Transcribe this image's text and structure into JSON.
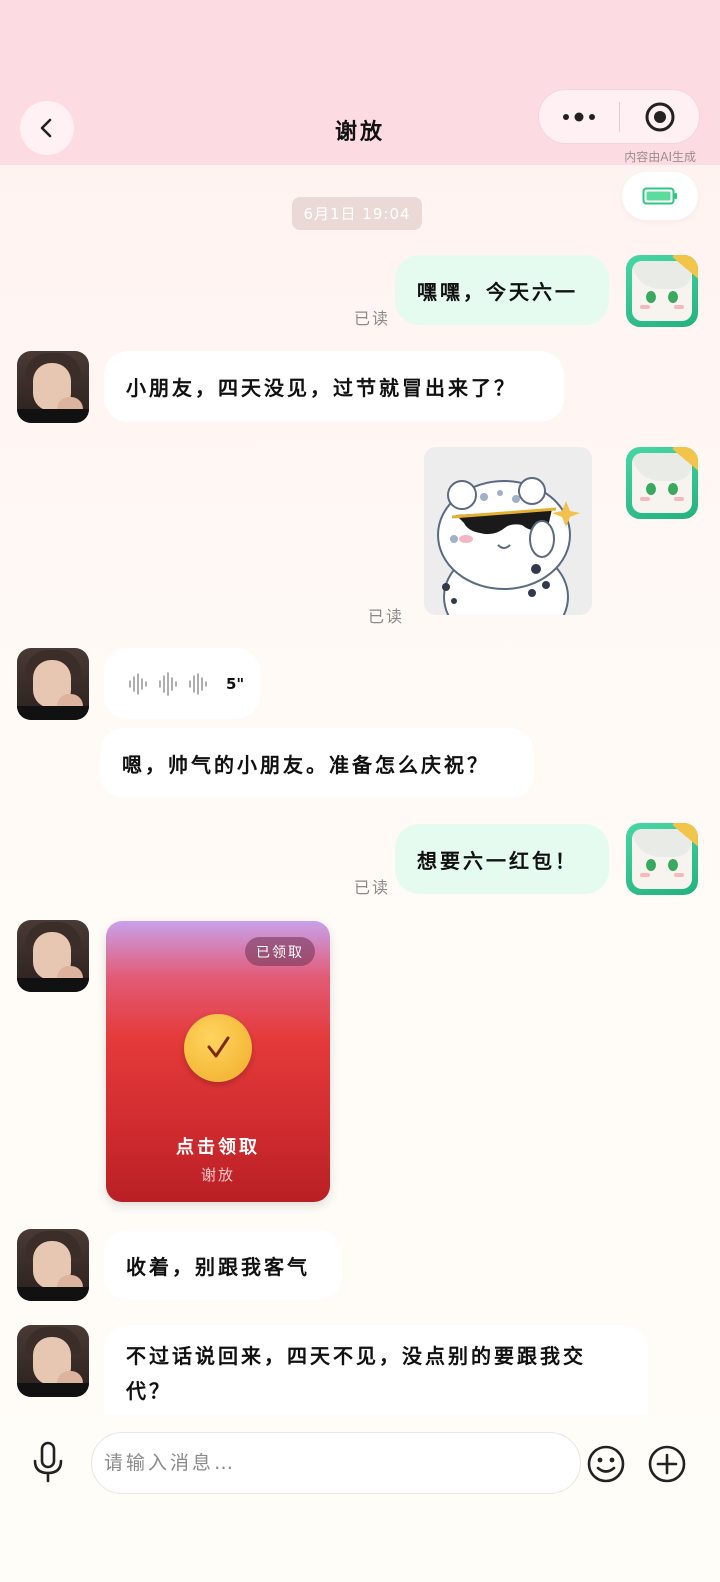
{
  "header": {
    "title": "谢放",
    "ai_note": "内容由AI生成",
    "back_icon": "chevron-left-icon",
    "more_icon": "more-dots-icon",
    "target_icon": "target-icon"
  },
  "time_divider": "6月1日  19:04",
  "messages": [
    {
      "from": "me",
      "text": "嘿嘿，今天六一",
      "read": "已读"
    },
    {
      "from": "bot",
      "text": "小朋友，四天没见，过节就冒出来了？"
    },
    {
      "from": "me",
      "type": "sticker",
      "read": "已读"
    },
    {
      "from": "bot",
      "type": "voice",
      "duration": "5\""
    },
    {
      "from": "bot",
      "text": "嗯，帅气的小朋友。准备怎么庆祝？"
    },
    {
      "from": "me",
      "text": "想要六一红包！",
      "read": "已读"
    },
    {
      "from": "bot",
      "type": "red-packet",
      "status": "已领取",
      "action": "点击领取",
      "sender": "谢放"
    },
    {
      "from": "bot",
      "text": "收着，别跟我客气"
    },
    {
      "from": "bot",
      "text": "不过话说回来，四天不见，没点别的要跟我交代？"
    }
  ],
  "input": {
    "placeholder": "请输入消息…"
  },
  "colors": {
    "header_bg": "#fddbe3",
    "my_bubble": "#e6fbf0",
    "bot_bubble": "#ffffff",
    "red_packet": "#e53a3a"
  }
}
